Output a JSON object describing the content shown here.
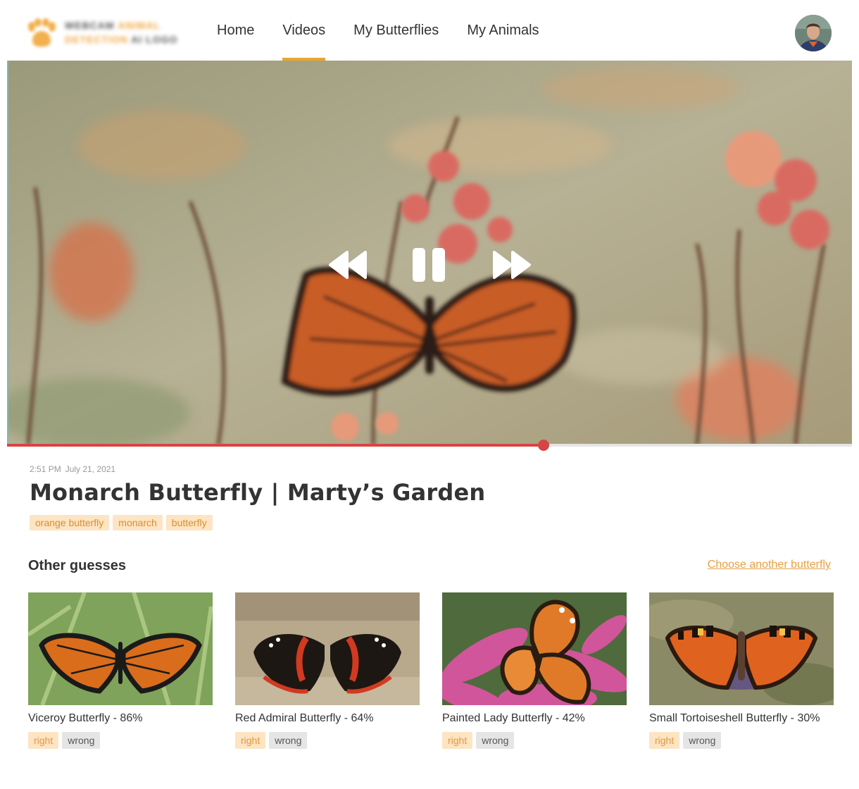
{
  "header": {
    "logo": {
      "line1_a": "WEBCAM",
      "line1_b": "ANIMAL",
      "line2_a": "DETECTION",
      "line2_b": "AI LOGO"
    },
    "nav": [
      {
        "label": "Home",
        "active": false
      },
      {
        "label": "Videos",
        "active": true
      },
      {
        "label": "My Butterflies",
        "active": false
      },
      {
        "label": "My Animals",
        "active": false
      }
    ]
  },
  "video": {
    "progress_fraction": 0.635,
    "controls": {
      "rewind_icon": "rewind-icon",
      "pause_icon": "pause-icon",
      "fast_forward_icon": "fast-forward-icon"
    }
  },
  "info": {
    "time": "2:51 PM",
    "date": "July 21, 2021",
    "title": "Monarch Butterfly | Marty’s Garden",
    "tags": [
      "orange butterfly",
      "monarch",
      "butterfly"
    ]
  },
  "guesses": {
    "heading": "Other guesses",
    "choose_link": "Choose another butterfly",
    "items": [
      {
        "name": "Viceroy Butterfly - 86%",
        "right": "right",
        "wrong": "wrong"
      },
      {
        "name": "Red Admiral Butterfly - 64%",
        "right": "right",
        "wrong": "wrong"
      },
      {
        "name": "Painted Lady Butterfly - 42%",
        "right": "right",
        "wrong": "wrong"
      },
      {
        "name": "Small Tortoiseshell Butterfly - 30%",
        "right": "right",
        "wrong": "wrong"
      }
    ]
  },
  "colors": {
    "accent": "#e8a530",
    "progress": "#d64545",
    "tag_bg": "#fde4c3",
    "tag_text": "#d9902e"
  }
}
